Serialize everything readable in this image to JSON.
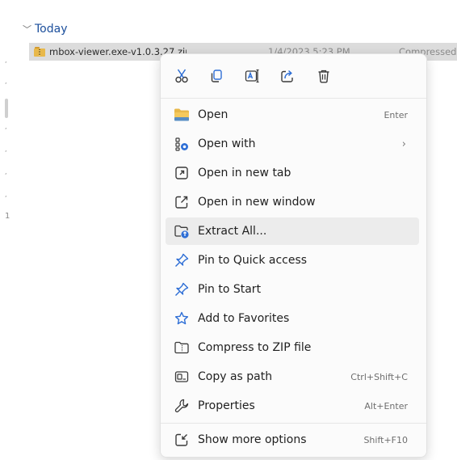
{
  "explorer": {
    "group_label": "Today",
    "file": {
      "name": "mbox-viewer.exe-v1.0.3.27.zip",
      "date": "1/4/2023 5:23 PM",
      "type": "Compressed"
    },
    "left_marks": [
      ",",
      ",",
      ",",
      ",",
      ",",
      ",",
      "1"
    ]
  },
  "quick_actions": [
    {
      "name": "cut",
      "icon": "scissors-icon"
    },
    {
      "name": "copy",
      "icon": "copy-icon"
    },
    {
      "name": "rename",
      "icon": "rename-icon"
    },
    {
      "name": "share",
      "icon": "share-icon"
    },
    {
      "name": "delete",
      "icon": "trash-icon"
    }
  ],
  "menu": {
    "items": [
      {
        "label": "Open",
        "shortcut": "Enter",
        "icon": "folder-icon"
      },
      {
        "label": "Open with",
        "shortcut": "",
        "icon": "open-with-icon",
        "submenu": "›"
      },
      {
        "label": "Open in new tab",
        "shortcut": "",
        "icon": "new-tab-icon"
      },
      {
        "label": "Open in new window",
        "shortcut": "",
        "icon": "new-window-icon"
      },
      {
        "label": "Extract All...",
        "shortcut": "",
        "icon": "extract-icon"
      },
      {
        "label": "Pin to Quick access",
        "shortcut": "",
        "icon": "pin-icon"
      },
      {
        "label": "Pin to Start",
        "shortcut": "",
        "icon": "pin-icon"
      },
      {
        "label": "Add to Favorites",
        "shortcut": "",
        "icon": "star-icon"
      },
      {
        "label": "Compress to ZIP file",
        "shortcut": "",
        "icon": "zip-icon"
      },
      {
        "label": "Copy as path",
        "shortcut": "Ctrl+Shift+C",
        "icon": "copy-path-icon"
      },
      {
        "label": "Properties",
        "shortcut": "Alt+Enter",
        "icon": "wrench-icon"
      },
      {
        "label": "Show more options",
        "shortcut": "Shift+F10",
        "icon": "more-options-icon"
      }
    ]
  },
  "colors": {
    "accent_blue": "#2f6fd6",
    "header_blue": "#1c4f9c",
    "folder_yellow": "#e8b84a",
    "hover_bg": "#ececec",
    "selection_bg": "#dcdcdc"
  }
}
